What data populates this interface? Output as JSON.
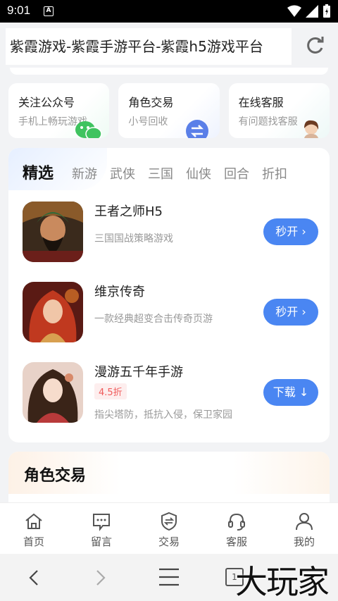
{
  "status_bar": {
    "time": "9:01",
    "notification_badge": "A"
  },
  "browser": {
    "page_title": "紫霞游戏-紫霞手游平台-紫霞h5游戏平台"
  },
  "quick_cards": [
    {
      "title": "关注公众号",
      "subtitle": "手机上畅玩游戏",
      "icon": "wechat-icon"
    },
    {
      "title": "角色交易",
      "subtitle": "小号回收",
      "icon": "swap-icon"
    },
    {
      "title": "在线客服",
      "subtitle": "有问题找客服",
      "icon": "support-agent-icon"
    }
  ],
  "featured": {
    "active_tab": "精选",
    "tabs": [
      "新游",
      "武侠",
      "三国",
      "仙侠",
      "回合",
      "折扣"
    ],
    "games": [
      {
        "name": "王者之师H5",
        "desc": "三国国战策略游戏",
        "button": "秒开"
      },
      {
        "name": "维京传奇",
        "desc": "一款经典超变合击传奇页游",
        "button": "秒开"
      },
      {
        "name": "漫游五千年手游",
        "tag": "4.5折",
        "desc": "指尖塔防，抵抗入侵，保卫家园",
        "button": "下载"
      }
    ]
  },
  "role_section": {
    "title": "角色交易"
  },
  "bottom_nav": [
    {
      "label": "首页",
      "icon": "home-icon"
    },
    {
      "label": "留言",
      "icon": "message-icon"
    },
    {
      "label": "交易",
      "icon": "trade-shield-icon"
    },
    {
      "label": "客服",
      "icon": "headset-icon"
    },
    {
      "label": "我的",
      "icon": "user-icon"
    }
  ],
  "system_nav": {
    "tab_count": "1"
  },
  "watermark": "大玩家",
  "colors": {
    "accent": "#4a86f2",
    "discount": "#f05b5b"
  }
}
